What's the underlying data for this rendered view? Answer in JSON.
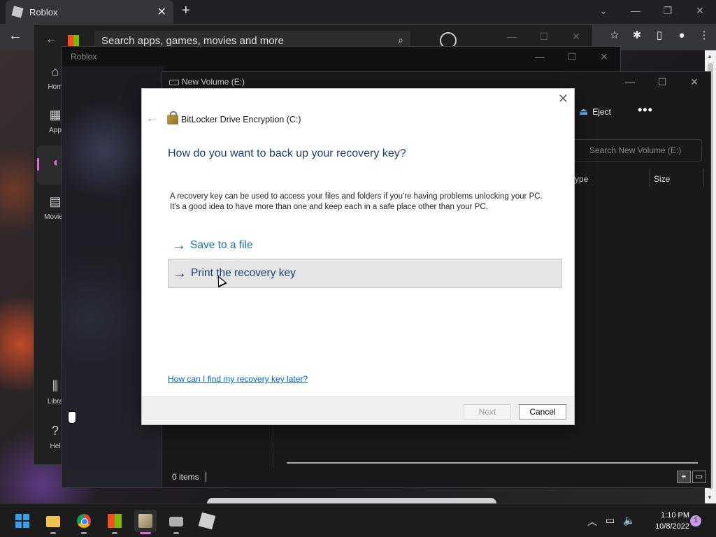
{
  "chrome": {
    "tab_title": "Roblox",
    "tab_close": "✕",
    "new_tab": "+"
  },
  "store": {
    "search_placeholder": "Search apps, games, movies and more",
    "nav": [
      {
        "label": "Hom",
        "icon": "home-icon"
      },
      {
        "label": "App",
        "icon": "apps-icon"
      },
      {
        "label": "",
        "icon": "gaming-icon"
      },
      {
        "label": "Movies",
        "icon": "movies-icon"
      },
      {
        "label": "Libra",
        "icon": "library-icon"
      },
      {
        "label": "Hel",
        "icon": "help-icon"
      }
    ]
  },
  "roblox": {
    "window_title": "Roblox"
  },
  "explorer": {
    "window_title": "New Volume (E:)",
    "eject_label": "Eject",
    "more_label": "•••",
    "search_placeholder": "Search New Volume (E:)",
    "columns": [
      "ype",
      "Size"
    ],
    "status": "0 items"
  },
  "dialog": {
    "app_title": "BitLocker Drive Encryption (C:)",
    "heading": "How do you want to back up your recovery key?",
    "description_line1": "A recovery key can be used to access your files and folders if you're having problems unlocking your PC.",
    "description_line2": "It's a good idea to have more than one and keep each in a safe place other than your PC.",
    "options": [
      {
        "label": "Save to a file",
        "highlighted": false
      },
      {
        "label": "Print the recovery key",
        "highlighted": true
      }
    ],
    "help_link": "How can I find my recovery key later?",
    "next_label": "Next",
    "cancel_label": "Cancel"
  },
  "taskbar": {
    "apps": [
      "start-icon",
      "file-explorer-icon",
      "chrome-icon",
      "microsoft-store-icon",
      "bitlocker-icon",
      "drive-icon",
      "roblox-icon"
    ],
    "time": "1:10 PM",
    "date": "10/8/2022",
    "notification_count": "1"
  },
  "colors": {
    "dialog_heading": "#1a3f74",
    "option_link": "#1f6fa8",
    "hover_bg": "#e5e5e5",
    "active_indicator": "#e06ad8"
  }
}
